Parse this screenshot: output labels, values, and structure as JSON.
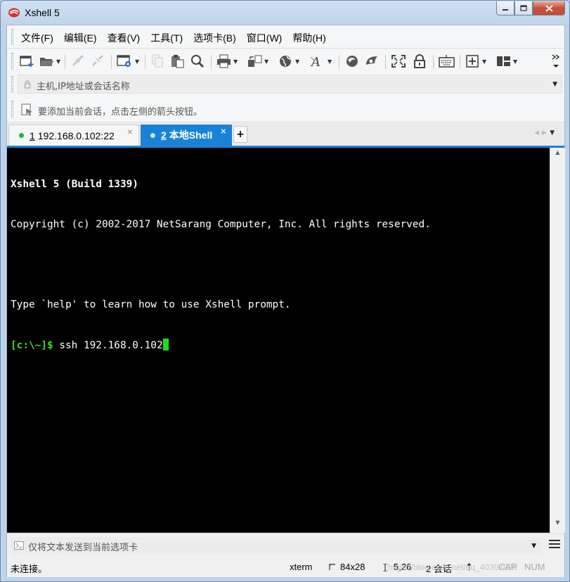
{
  "window": {
    "title": "Xshell 5",
    "icon": "xshell-logo-icon",
    "buttons": {
      "minimize": "minimize-icon",
      "maximize": "maximize-icon",
      "close": "close-icon"
    }
  },
  "menu": {
    "items": [
      {
        "label": "文件(F)"
      },
      {
        "label": "编辑(E)"
      },
      {
        "label": "查看(V)"
      },
      {
        "label": "工具(T)"
      },
      {
        "label": "选项卡(B)"
      },
      {
        "label": "窗口(W)"
      },
      {
        "label": "帮助(H)"
      }
    ]
  },
  "toolbar": {
    "icons": [
      "new-session-icon",
      "open-folder-icon",
      "connect-icon",
      "disconnect-icon",
      "properties-icon",
      "copy-icon",
      "paste-icon",
      "find-icon",
      "print-icon",
      "transfer-icon",
      "globe-icon",
      "font-icon",
      "xftp-icon",
      "xmanager-icon",
      "fullscreen-icon",
      "lock-icon",
      "keyboard-icon",
      "compose-icon",
      "layout-icon",
      "overflow-icon"
    ]
  },
  "address": {
    "placeholder": "主机,IP地址或会话名称"
  },
  "hint": {
    "text": "要添加当前会话，点击左侧的箭头按钮。"
  },
  "tabs": [
    {
      "number": "1",
      "label": "192.168.0.102:22",
      "status_color": "#22b14c",
      "active": false
    },
    {
      "number": "2",
      "label": "本地Shell",
      "status_color": "#c8e4fb",
      "active": true
    }
  ],
  "tab_add_label": "+",
  "terminal": {
    "lines": [
      "Xshell 5 (Build 1339)",
      "Copyright (c) 2002-2017 NetSarang Computer, Inc. All rights reserved.",
      "",
      "Type `help' to learn how to use Xshell prompt."
    ],
    "prompt": "[c:\\~]$",
    "command": " ssh 192.168.0.102"
  },
  "compose": {
    "placeholder": "仅将文本发送到当前选项卡"
  },
  "status": {
    "connection": "未连接。",
    "terminal_type": "xterm",
    "size": "84x28",
    "cursor_pos": "5,26",
    "sessions": "2 会话",
    "cap": "CAP",
    "num": "NUM",
    "watermark": "https://blog.csdn.net/qq_40301026"
  },
  "colors": {
    "accent": "#1a82d6",
    "terminal_bg": "#000000",
    "prompt": "#35e035",
    "cursor": "#19e019"
  }
}
